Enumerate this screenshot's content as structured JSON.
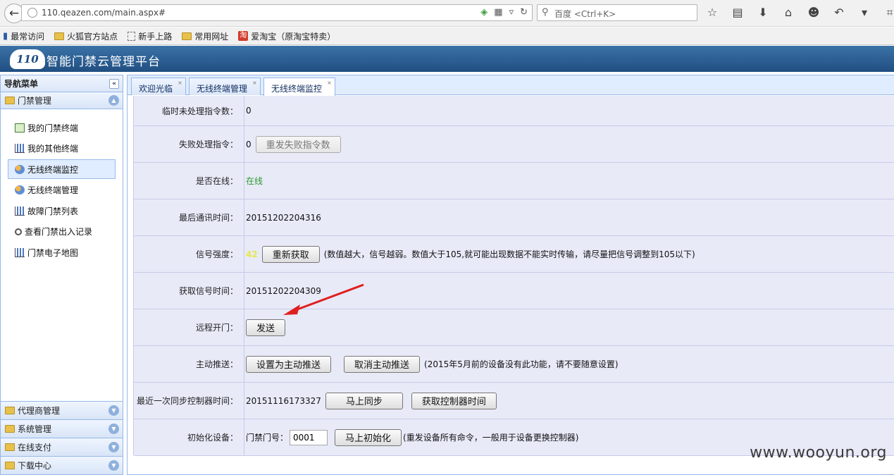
{
  "browser": {
    "url": "110.qeazen.com/main.aspx#",
    "search_placeholder": "百度 <Ctrl+K>",
    "bookmarks": [
      "最常访问",
      "火狐官方站点",
      "新手上路",
      "常用网址",
      "爱淘宝（原淘宝特卖）"
    ],
    "taobao_glyph": "淘"
  },
  "app": {
    "logo_text": "110",
    "title": "智能门禁云管理平台"
  },
  "sidebar": {
    "title": "导航菜单",
    "group": "门禁管理",
    "items": [
      {
        "label": "我的门禁终端",
        "icon": "terminal-icon"
      },
      {
        "label": "我的其他终端",
        "icon": "chart-icon"
      },
      {
        "label": "无线终端监控",
        "icon": "users-icon",
        "active": true
      },
      {
        "label": "无线终端管理",
        "icon": "users-icon"
      },
      {
        "label": "故障门禁列表",
        "icon": "chart-icon"
      },
      {
        "label": "查看门禁出入记录",
        "icon": "magnifier-icon"
      },
      {
        "label": "门禁电子地图",
        "icon": "chart-icon"
      }
    ],
    "bottom_panels": [
      "代理商管理",
      "系统管理",
      "在线支付",
      "下载中心"
    ]
  },
  "tabs": [
    {
      "label": "欢迎光临"
    },
    {
      "label": "无线终端管理"
    },
    {
      "label": "无线终端监控",
      "active": true
    }
  ],
  "form": {
    "pending_label": "临时未处理指令数：",
    "pending_value": "0",
    "failed_label": "失败处理指令：",
    "failed_value": "0",
    "resend_btn": "重发失败指令数",
    "online_label": "是否在线：",
    "online_value": "在线",
    "last_comm_label": "最后通讯时间：",
    "last_comm_value": "20151202204316",
    "signal_label": "信号强度：",
    "signal_value": "42",
    "refetch_btn": "重新获取",
    "signal_note": "(数值越大，信号越弱。数值大于105,就可能出现数据不能实时传输，请尽量把信号调整到105以下)",
    "signal_time_label": "获取信号时间：",
    "signal_time_value": "20151202204309",
    "remote_open_label": "远程开门：",
    "send_btn": "发送",
    "push_label": "主动推送：",
    "set_push_btn": "设置为主动推送",
    "cancel_push_btn": "取消主动推送",
    "push_note": "(2015年5月前的设备没有此功能，请不要随意设置)",
    "sync_label": "最近一次同步控制器时间：",
    "sync_value": "20151116173327",
    "sync_now_btn": "马上同步",
    "get_time_btn": "获取控制器时间",
    "init_label": "初始化设备：",
    "door_no_label": "门禁门号：",
    "door_no_value": "0001",
    "init_btn": "马上初始化",
    "init_note": "(重发设备所有命令，一般用于设备更换控制器)"
  },
  "colors": {
    "header_blue": "#2a5e94",
    "online_green": "#2a9a2a",
    "signal_yellow": "#e8e84a",
    "annotation_red": "#e02020"
  },
  "watermark": "www.wooyun.org"
}
